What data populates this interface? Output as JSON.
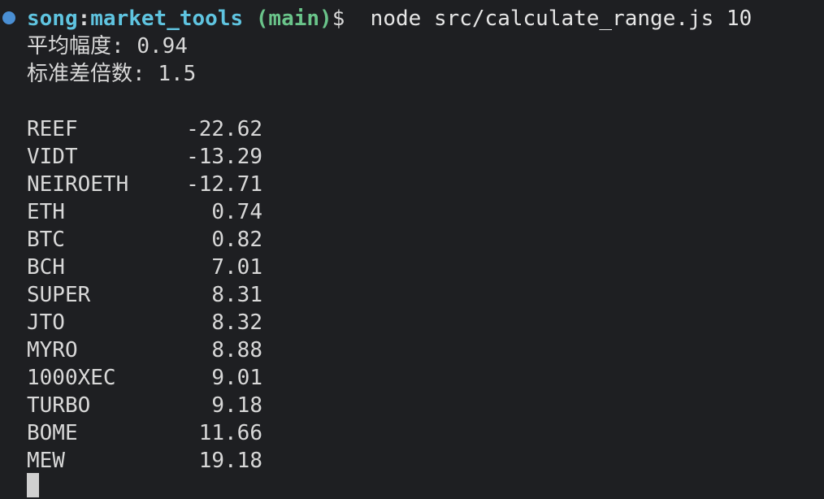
{
  "prompt": {
    "user": "song",
    "colon": ":",
    "path": "market_tools",
    "branch": "(main)",
    "dollar": "$",
    "command": "node src/calculate_range.js 10",
    "dot_color": "#4a8fd4"
  },
  "stats": {
    "avg_label": "平均幅度: ",
    "avg_value": "0.94",
    "std_label": "标准差倍数: ",
    "std_value": "1.5"
  },
  "rows": [
    {
      "symbol": "REEF",
      "value": "-22.62"
    },
    {
      "symbol": "VIDT",
      "value": "-13.29"
    },
    {
      "symbol": "NEIROETH",
      "value": "-12.71"
    },
    {
      "symbol": "ETH",
      "value": "0.74"
    },
    {
      "symbol": "BTC",
      "value": "0.82"
    },
    {
      "symbol": "BCH",
      "value": "7.01"
    },
    {
      "symbol": "SUPER",
      "value": "8.31"
    },
    {
      "symbol": "JTO",
      "value": "8.32"
    },
    {
      "symbol": "MYRO",
      "value": "8.88"
    },
    {
      "symbol": "1000XEC",
      "value": "9.01"
    },
    {
      "symbol": "TURBO",
      "value": "9.18"
    },
    {
      "symbol": "BOME",
      "value": "11.66"
    },
    {
      "symbol": "MEW",
      "value": "19.18"
    }
  ]
}
